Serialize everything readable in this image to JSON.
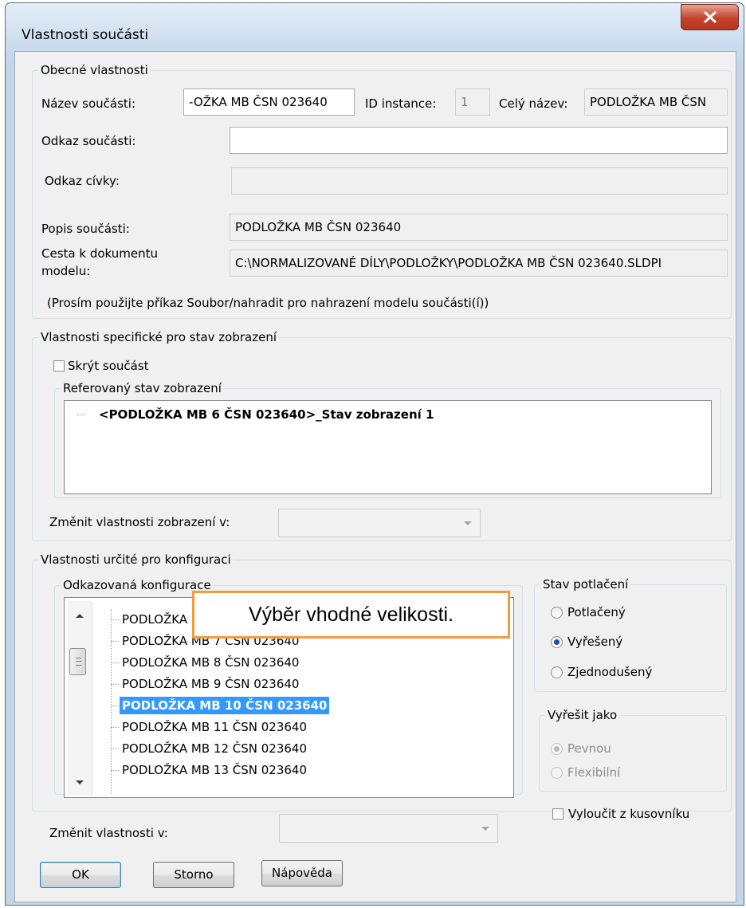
{
  "window": {
    "title": "Vlastnosti součásti"
  },
  "general": {
    "group_label": "Obecné vlastnosti",
    "name_label": "Název součásti:",
    "name_value": "-OŽKA MB ČSN 023640",
    "instance_label": "ID instance:",
    "instance_value": "1",
    "fullname_label": "Celý název:",
    "fullname_value": "PODLOŽKA MB ČSN",
    "ref_label": "Odkaz součásti:",
    "ref_value": "",
    "coil_label": "Odkaz cívky:",
    "coil_value": "",
    "desc_label": "Popis součásti:",
    "desc_value": "PODLOŽKA MB ČSN 023640",
    "path_label_line1": "Cesta k dokumentu",
    "path_label_line2": "modelu:",
    "path_value": "C:\\NORMALIZOVANÉ DÍLY\\PODLOŽKY\\PODLOŽKA MB ČSN 023640.SLDPI",
    "note": "(Prosím použijte příkaz Soubor/nahradit pro nahrazení modelu součásti(í))"
  },
  "display": {
    "group_label": "Vlastnosti specifické pro stav zobrazení",
    "hide_label": "Skrýt součást",
    "hide_checked": false,
    "ref_group_label": "Referovaný stav zobrazení",
    "state_item": "<PODLOŽKA  MB 6 ČSN 023640>_Stav zobrazení 1",
    "change_label": "Změnit vlastnosti zobrazení v:"
  },
  "config": {
    "group_label": "Vlastnosti určité pro konfiguraci",
    "ref_group_label": "Odkazovaná konfigurace",
    "items": [
      "PODLOŽKA  MB 6 ČSN 023640",
      "PODLOŽKA  MB 7 ČSN 023640",
      "PODLOŽKA  MB 8 ČSN 023640",
      "PODLOŽKA  MB 9 ČSN 023640",
      "PODLOŽKA MB 10 ČSN 023640",
      "PODLOŽKA MB 11 ČSN 023640",
      "PODLOŽKA MB 12 ČSN 023640",
      "PODLOŽKA MB 13 ČSN 023640"
    ],
    "selected_index": 4,
    "change_label": "Změnit vlastnosti v:",
    "callout": "Výběr vhodné velikosti."
  },
  "suppression": {
    "group_label": "Stav potlačení",
    "options": [
      "Potlačený",
      "Vyřešený",
      "Zjednodušený"
    ],
    "selected": "Vyřešený"
  },
  "resolve": {
    "group_label": "Vyřešit jako",
    "options": [
      "Pevnou",
      "Flexibilní"
    ],
    "selected": "Pevnou"
  },
  "exclude": {
    "label": "Vyloučit z kusovníku",
    "checked": false
  },
  "buttons": {
    "ok": "OK",
    "cancel": "Storno",
    "help": "Nápověda"
  },
  "colors": {
    "selection": "#3399ff",
    "callout_border": "#f39a3e",
    "close_button": "#c4432e"
  }
}
